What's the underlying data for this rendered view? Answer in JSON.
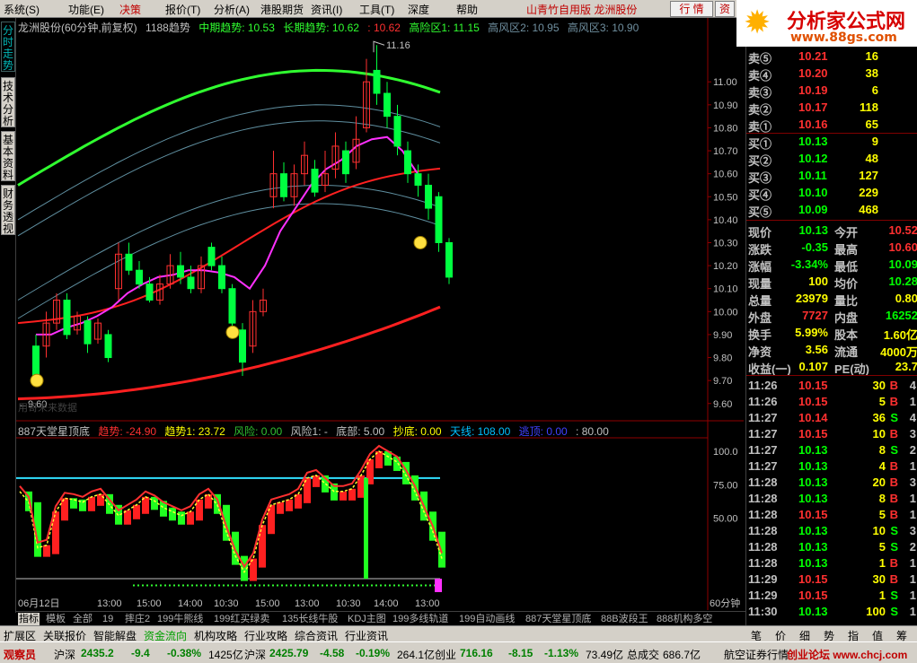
{
  "menu": {
    "items": [
      "系统",
      "功能",
      "决策",
      "报价",
      "分析",
      "港股期货",
      "资讯",
      "工具",
      "深度",
      "帮助"
    ],
    "shortcuts": [
      "(S)",
      "(E)",
      "",
      "(T)",
      "(A)",
      "",
      "(I)",
      "(T)",
      "",
      ""
    ],
    "title": "山青竹自用版  龙洲股份",
    "btn_quote": "行 情",
    "btn_info": "资"
  },
  "logo": {
    "text": "分析家公式网",
    "url_text": "www.88gs.com"
  },
  "left_tabs": [
    "分时走势",
    "技术分析",
    "基本资料",
    "财务透视"
  ],
  "main_chart": {
    "header": {
      "name": "龙洲股份(60分钟,前复权)",
      "indicator": "1188趋势",
      "mid_trend": "中期趋势: 10.53",
      "long_trend": "长期趋势: 10.62",
      "v3": ": 10.62",
      "high_zone1": "高险区1: 11.15",
      "high_zone2": "高风区2: 10.95",
      "high_zone3": "高风区3: 10.90"
    },
    "price_axis": [
      "11.00",
      "10.90",
      "10.80",
      "10.70",
      "10.60",
      "10.50",
      "10.40",
      "10.30",
      "10.20",
      "10.10",
      "10.00",
      "9.90",
      "9.80",
      "9.70",
      "9.60"
    ],
    "high_marker": "11.16",
    "low_marker": "9.60",
    "watermark": "用哥未来数据",
    "colors": {
      "up": "#ff3030",
      "down": "#00ff40",
      "upper_band": "#30ff30",
      "lower_band": "#ff2020",
      "mid": "#ff30ff"
    }
  },
  "ind_chart": {
    "header": {
      "name": "887天堂星顶底",
      "t1": "趋势: -24.90",
      "t2": "趋势1: 23.72",
      "risk": "风险: 0.00",
      "risk1": "风险1: -",
      "bottom": "底部: 5.00",
      "buy": "抄底: 0.00",
      "sky": "天线: 108.00",
      "escape": "逃顶: 0.00",
      "v80": ": 80.00"
    },
    "axis": [
      "100.0",
      "75.00",
      "50.00"
    ],
    "period": "60分钟",
    "time_labels": [
      "06月12日",
      "13:00",
      "15:00",
      "14:00",
      "10:30",
      "15:00",
      "13:00",
      "10:30",
      "14:00",
      "13:00"
    ]
  },
  "orderbook": [
    {
      "label": "卖⑤",
      "price": "10.21",
      "vol": "16"
    },
    {
      "label": "卖④",
      "price": "10.20",
      "vol": "38"
    },
    {
      "label": "卖③",
      "price": "10.19",
      "vol": "6"
    },
    {
      "label": "卖②",
      "price": "10.17",
      "vol": "118"
    },
    {
      "label": "卖①",
      "price": "10.16",
      "vol": "65"
    },
    {
      "label": "买①",
      "price": "10.13",
      "vol": "9"
    },
    {
      "label": "买②",
      "price": "10.12",
      "vol": "48"
    },
    {
      "label": "买③",
      "price": "10.11",
      "vol": "127"
    },
    {
      "label": "买④",
      "price": "10.10",
      "vol": "229"
    },
    {
      "label": "买⑤",
      "price": "10.09",
      "vol": "468"
    }
  ],
  "quote": [
    {
      "l1": "现价",
      "v1": "10.13",
      "c1": "#00ff00",
      "l2": "今开",
      "v2": "10.52",
      "c2": "#ff3030"
    },
    {
      "l1": "涨跌",
      "v1": "-0.35",
      "c1": "#00ff00",
      "l2": "最高",
      "v2": "10.60",
      "c2": "#ff3030"
    },
    {
      "l1": "涨幅",
      "v1": "-3.34%",
      "c1": "#00ff00",
      "l2": "最低",
      "v2": "10.09",
      "c2": "#00ff00"
    },
    {
      "l1": "现量",
      "v1": "100",
      "c1": "#ffff00",
      "l2": "均价",
      "v2": "10.28",
      "c2": "#00ff00"
    },
    {
      "l1": "总量",
      "v1": "23979",
      "c1": "#ffff00",
      "l2": "量比",
      "v2": "0.80",
      "c2": "#ffff00"
    },
    {
      "l1": "外盘",
      "v1": "7727",
      "c1": "#ff3030",
      "l2": "内盘",
      "v2": "16252",
      "c2": "#00ff00"
    },
    {
      "l1": "换手",
      "v1": "5.99%",
      "c1": "#ffff00",
      "l2": "股本",
      "v2": "1.60亿",
      "c2": "#ffff00"
    },
    {
      "l1": "净资",
      "v1": "3.56",
      "c1": "#ffff00",
      "l2": "流通",
      "v2": "4000万",
      "c2": "#ffff00"
    },
    {
      "l1": "收益(一)",
      "v1": "0.107",
      "c1": "#ffff00",
      "l2": "PE(动)",
      "v2": "23.7",
      "c2": "#ffff00"
    }
  ],
  "ticks": [
    {
      "time": "11:26",
      "price": "10.15",
      "vol": "30",
      "bs": "B",
      "n": "4"
    },
    {
      "time": "11:26",
      "price": "10.15",
      "vol": "5",
      "bs": "B",
      "n": "1"
    },
    {
      "time": "11:27",
      "price": "10.14",
      "vol": "36",
      "bs": "S",
      "n": "4"
    },
    {
      "time": "11:27",
      "price": "10.15",
      "vol": "10",
      "bs": "B",
      "n": "3"
    },
    {
      "time": "11:27",
      "price": "10.13",
      "vol": "8",
      "bs": "S",
      "n": "2"
    },
    {
      "time": "11:27",
      "price": "10.13",
      "vol": "4",
      "bs": "B",
      "n": "1"
    },
    {
      "time": "11:28",
      "price": "10.13",
      "vol": "20",
      "bs": "B",
      "n": "3"
    },
    {
      "time": "11:28",
      "price": "10.13",
      "vol": "8",
      "bs": "B",
      "n": "1"
    },
    {
      "time": "11:28",
      "price": "10.15",
      "vol": "5",
      "bs": "B",
      "n": "1"
    },
    {
      "time": "11:28",
      "price": "10.13",
      "vol": "10",
      "bs": "S",
      "n": "3"
    },
    {
      "time": "11:28",
      "price": "10.13",
      "vol": "5",
      "bs": "S",
      "n": "2"
    },
    {
      "time": "11:28",
      "price": "10.13",
      "vol": "1",
      "bs": "B",
      "n": "1"
    },
    {
      "time": "11:29",
      "price": "10.15",
      "vol": "30",
      "bs": "B",
      "n": "1"
    },
    {
      "time": "11:29",
      "price": "10.15",
      "vol": "1",
      "bs": "S",
      "n": "1"
    },
    {
      "time": "11:30",
      "price": "10.13",
      "vol": "100",
      "bs": "S",
      "n": "1"
    }
  ],
  "ind_tabs": [
    "指标",
    "模板",
    "全部",
    "19",
    "摔庄2",
    "199牛熊线",
    "199红买绿卖",
    "135长线牛股",
    "KDJ主图",
    "199多线轨道",
    "199自动画线",
    "887天堂星顶底",
    "88B波段王",
    "888机构多空"
  ],
  "page_tabs": [
    "扩展区",
    "关联报价",
    "智能解盘",
    "资金流向",
    "机构攻略",
    "行业攻略",
    "综合资讯",
    "行业资讯"
  ],
  "right_tabs": [
    "笔",
    "价",
    "细",
    "势",
    "指",
    "值",
    "筹"
  ],
  "status": {
    "user": "观察员",
    "sh_label": "沪深",
    "sh_val": "2435.2",
    "sh_chg": "-9.4",
    "sh_pct": "-0.38%",
    "sh_amt": "1425亿",
    "sz_label": "沪深",
    "sz_val": "2425.79",
    "sz_chg": "-4.58",
    "sz_pct": "-0.19%",
    "sz_amt": "264.1亿",
    "cy_label": "创业",
    "cy_val": "716.16",
    "cy_chg": "-8.15",
    "cy_pct": "-1.13%",
    "cy_amt": "73.49亿",
    "deal_label": "总成交",
    "deal_val": "686.7亿",
    "broker": "航空证券行情",
    "forum": "创业论坛 www.chcj.com"
  }
}
